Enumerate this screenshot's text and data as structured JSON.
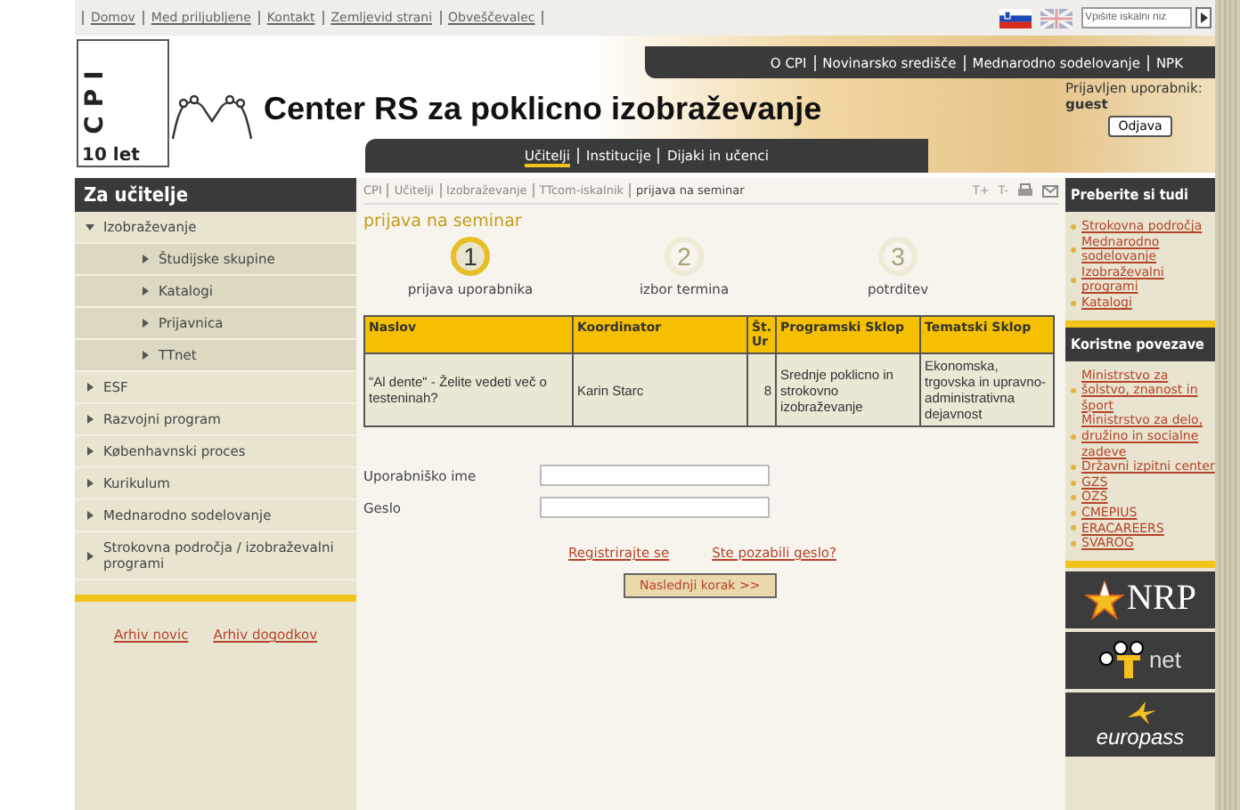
{
  "top_links": [
    "Domov",
    "Med priljubljene",
    "Kontakt",
    "Zemljevid strani",
    "Obveščevalec"
  ],
  "languages": [
    {
      "kind": "si",
      "selected": true
    },
    {
      "kind": "gb",
      "selected": false
    }
  ],
  "search": {
    "placeholder": "Vpišite iskalni niz"
  },
  "logo": {
    "letters": "CPI",
    "anniversary": "10 let"
  },
  "site_title": "Center RS za poklicno izobraževanje",
  "top_nav": [
    "O CPI",
    "Novinarsko središče",
    "Mednarodno sodelovanje",
    "NPK"
  ],
  "user": {
    "label": "Prijavljen uporabnik:",
    "name": "guest",
    "logout": "Odjava"
  },
  "main_nav": [
    {
      "label": "Učitelji",
      "selected": true
    },
    {
      "label": "Institucije",
      "selected": false
    },
    {
      "label": "Dijaki in učenci",
      "selected": false
    }
  ],
  "sidebar": {
    "title": "Za učitelje",
    "items": [
      {
        "label": "Izobraževanje",
        "expanded": true,
        "children": [
          {
            "label": "Študijske skupine"
          },
          {
            "label": "Katalogi"
          },
          {
            "label": "Prijavnica"
          },
          {
            "label": "TTnet"
          }
        ]
      },
      {
        "label": "ESF",
        "expanded": false
      },
      {
        "label": "Razvojni program",
        "expanded": false
      },
      {
        "label": "Københavnski proces",
        "expanded": false
      },
      {
        "label": "Kurikulum",
        "expanded": false
      },
      {
        "label": "Mednarodno sodelovanje",
        "expanded": false
      },
      {
        "label": "Strokovna področja / izobraževalni programi",
        "expanded": false
      }
    ],
    "archive_links": [
      "Arhiv novic",
      "Arhiv dogodkov"
    ]
  },
  "breadcrumb": [
    "CPI",
    "Učitelji",
    "Izobraževanje",
    "TTcom-iskalnik",
    "prijava na seminar"
  ],
  "text_size_controls": [
    "T+",
    "T-"
  ],
  "page_title": "prijava na seminar",
  "steps": [
    {
      "number": "1",
      "label": "prijava uporabnika",
      "selected": true
    },
    {
      "number": "2",
      "label": "izbor termina",
      "selected": false
    },
    {
      "number": "3",
      "label": "potrditev",
      "selected": false
    }
  ],
  "table": {
    "columns": [
      "Naslov",
      "Koordinator",
      "Št. Ur",
      "Programski Sklop",
      "Tematski Sklop"
    ],
    "rows": [
      [
        "\"Al dente\" - Želite vedeti več o testeninah?",
        "Karin Starc",
        "8",
        "Srednje poklicno in strokovno izobraževanje",
        "Ekonomska, trgovska in upravno-administrativna dejavnost"
      ]
    ]
  },
  "form": {
    "fields": [
      {
        "label": "Uporabniško ime"
      },
      {
        "label": "Geslo"
      }
    ],
    "links": [
      "Registrirajte se",
      "Ste pozabili geslo?"
    ],
    "submit": "Naslednji korak >>"
  },
  "right_sidebar": [
    {
      "title": "Preberite si tudi",
      "links": [
        "Strokovna področja",
        "Mednarodno sodelovanje",
        "Izobraževalni programi",
        "Katalogi"
      ]
    },
    {
      "title": "Koristne povezave",
      "links": [
        "Ministrstvo za šolstvo, znanost in šport",
        "Ministrstvo za delo, družino in socialne zadeve",
        "Državni izpitni center",
        "GZS",
        "OZS",
        "CMEPIUS",
        "ERACAREERS",
        "SVAROG"
      ]
    }
  ],
  "partner_logos": [
    {
      "kind": "nrp",
      "text": "NRP"
    },
    {
      "kind": "ttnet",
      "text": "net"
    },
    {
      "kind": "europass",
      "text": "europass"
    }
  ]
}
